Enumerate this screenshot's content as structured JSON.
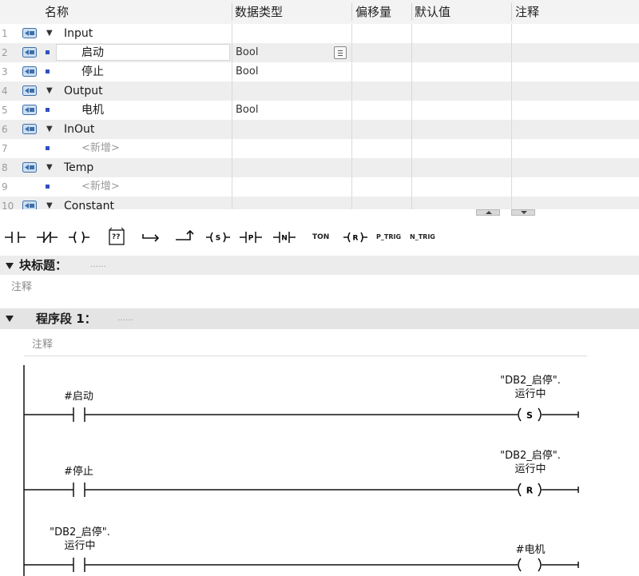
{
  "interface": {
    "columns": [
      "名称",
      "数据类型",
      "偏移量",
      "默认值",
      "注释"
    ],
    "rows": [
      {
        "num": "1",
        "name": "Input",
        "type": "section",
        "dtype": ""
      },
      {
        "num": "2",
        "name": "启动",
        "type": "var",
        "dtype": "Bool"
      },
      {
        "num": "3",
        "name": "停止",
        "type": "var",
        "dtype": "Bool"
      },
      {
        "num": "4",
        "name": "Output",
        "type": "section",
        "dtype": ""
      },
      {
        "num": "5",
        "name": "电机",
        "type": "var",
        "dtype": "Bool"
      },
      {
        "num": "6",
        "name": "InOut",
        "type": "section",
        "dtype": ""
      },
      {
        "num": "7",
        "name": "<新增>",
        "type": "placeholder",
        "dtype": ""
      },
      {
        "num": "8",
        "name": "Temp",
        "type": "section",
        "dtype": ""
      },
      {
        "num": "9",
        "name": "<新增>",
        "type": "placeholder",
        "dtype": ""
      },
      {
        "num": "10",
        "name": "Constant",
        "type": "section",
        "dtype": ""
      }
    ]
  },
  "toolbar": {
    "ton": "TON",
    "ptrig": "P_TRIG",
    "ntrig": "N_TRIG",
    "box_label": "??"
  },
  "block": {
    "title": "块标题：",
    "dots": "……",
    "comment": "注释"
  },
  "network": {
    "title": "程序段 1：",
    "dots": "……",
    "comment": "注释"
  },
  "ladder": {
    "rungs": [
      {
        "contact": "#启动",
        "coil_line1": "\"DB2_启停\".",
        "coil_line2": "运行中",
        "coil_type": "S"
      },
      {
        "contact": "#停止",
        "coil_line1": "\"DB2_启停\".",
        "coil_line2": "运行中",
        "coil_type": "R"
      },
      {
        "contact_line1": "\"DB2_启停\".",
        "contact_line2": "运行中",
        "coil": "#电机",
        "coil_type": ""
      }
    ]
  },
  "colors": {
    "link_icon": "#3d6fa8",
    "link_icon_light": "#cfe0f2",
    "var_dot": "#2f4fbf"
  }
}
